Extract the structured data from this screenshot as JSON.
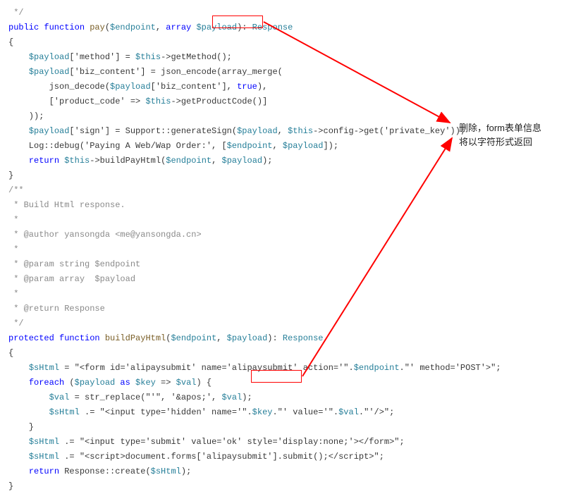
{
  "code": {
    "l0": " */",
    "l1_pre": "public function ",
    "l1_fn": "pay",
    "l1_args_open": "(",
    "l1_var1": "$endpoint",
    "l1_comma": ", ",
    "l1_array": "array ",
    "l1_var2": "$payload",
    "l1_args_close": "):",
    "l1_resp": " Response",
    "l2": "{",
    "l3_pre": "    ",
    "l3_var": "$payload",
    "l3_mid": "['method'] = ",
    "l3_this": "$this",
    "l3_call": "->getMethod();",
    "l4_pre": "    ",
    "l4_var": "$payload",
    "l4_mid": "['biz_content'] = json_encode(array_merge(",
    "l5_pre": "        json_decode(",
    "l5_var": "$payload",
    "l5_mid": "['biz_content'], ",
    "l5_true": "true",
    "l5_end": "),",
    "l6_pre": "        ['product_code' => ",
    "l6_this": "$this",
    "l6_end": "->getProductCode()]",
    "l7": "    ));",
    "l8_pre": "    ",
    "l8_var": "$payload",
    "l8_mid": "['sign'] = Support::generateSign(",
    "l8_var2": "$payload",
    "l8_mid2": ", ",
    "l8_this": "$this",
    "l8_end": "->config->get('private_key'));",
    "l9": "",
    "l10_pre": "    Log::debug('Paying A Web/Wap Order:', [",
    "l10_var1": "$endpoint",
    "l10_mid": ", ",
    "l10_var2": "$payload",
    "l10_end": "]);",
    "l11": "",
    "l12_pre": "    ",
    "l12_return": "return ",
    "l12_this": "$this",
    "l12_mid": "->buildPayHtml(",
    "l12_var1": "$endpoint",
    "l12_mid2": ", ",
    "l12_var2": "$payload",
    "l12_end": ");",
    "l13": "}",
    "l14": "",
    "l15": "/**",
    "l16": " * Build Html response.",
    "l17": " *",
    "l18": " * @author yansongda <me@yansongda.cn>",
    "l19": " *",
    "l20": " * @param string $endpoint",
    "l21": " * @param array  $payload",
    "l22": " *",
    "l23": " * @return Response",
    "l24": " */",
    "l25_pre": "protected function ",
    "l25_fn": "buildPayHtml",
    "l25_args_open": "(",
    "l25_var1": "$endpoint",
    "l25_mid": ", ",
    "l25_var2": "$payload",
    "l25_args_close": "):",
    "l25_resp": " Response",
    "l26": "{",
    "l27_pre": "    ",
    "l27_var": "$sHtml",
    "l27_mid": " = \"<form id='alipaysubmit' name='alipaysubmit' action='\".",
    "l27_var2": "$endpoint",
    "l27_end": ".\"' method='POST'>\";",
    "l28_pre": "    ",
    "l28_foreach": "foreach ",
    "l28_open": "(",
    "l28_var1": "$payload",
    "l28_as": " as ",
    "l28_var2": "$key",
    "l28_arrow": " => ",
    "l28_var3": "$val",
    "l28_end": ") {",
    "l29_pre": "        ",
    "l29_var": "$val",
    "l29_mid": " = str_replace(\"'\", '&apos;', ",
    "l29_var2": "$val",
    "l29_end": ");",
    "l30_pre": "        ",
    "l30_var": "$sHtml",
    "l30_mid": " .= \"<input type='hidden' name='\".",
    "l30_var2": "$key",
    "l30_mid2": ".\"' value='\".",
    "l30_var3": "$val",
    "l30_end": ".\"'/>\";",
    "l31": "    }",
    "l32_pre": "    ",
    "l32_var": "$sHtml",
    "l32_end": " .= \"<input type='submit' value='ok' style='display:none;'></form>\";",
    "l33_pre": "    ",
    "l33_var": "$sHtml",
    "l33_end": " .= \"<script>document.forms['alipaysubmit'].submit();</script>\";",
    "l34": "",
    "l35_pre": "    ",
    "l35_return": "return ",
    "l35_call": "Response::create(",
    "l35_var": "$sHtml",
    "l35_end": ");",
    "l36": "}"
  },
  "annotation": {
    "line1": "删除，form表单信息",
    "line2": "将以字符形式返回"
  }
}
